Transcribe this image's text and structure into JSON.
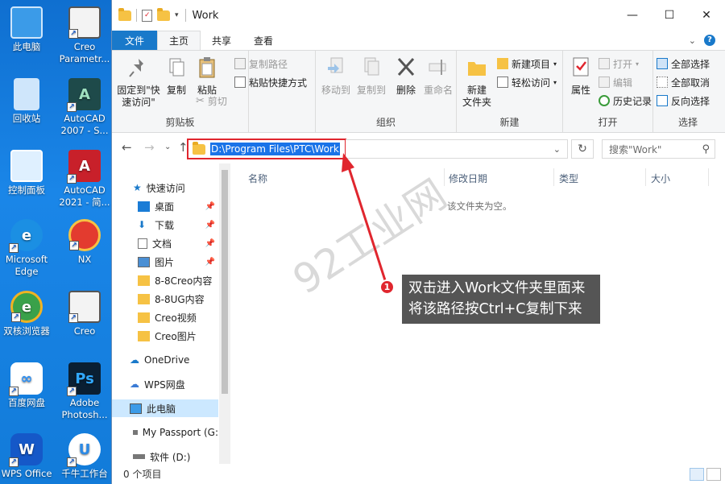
{
  "desktop": {
    "icons": [
      {
        "label": "此电脑"
      },
      {
        "label": "Creo Parametr..."
      },
      {
        "label": "回收站"
      },
      {
        "label": "AutoCAD 2007 - S..."
      },
      {
        "label": "控制面板"
      },
      {
        "label": "AutoCAD 2021 - 简..."
      },
      {
        "label": "Microsoft Edge"
      },
      {
        "label": "NX"
      },
      {
        "label": "双核浏览器"
      },
      {
        "label": "Creo"
      },
      {
        "label": "百度网盘"
      },
      {
        "label": "Adobe Photosh..."
      },
      {
        "label": "WPS Office"
      },
      {
        "label": "千牛工作台"
      }
    ]
  },
  "window": {
    "title": "Work",
    "controls": {
      "minimize": "—",
      "maximize": "☐",
      "close": "✕"
    }
  },
  "tabs": {
    "file": "文件",
    "home": "主页",
    "share": "共享",
    "view": "查看"
  },
  "ribbon": {
    "clipboard": {
      "pin": "固定到\"快速访问\"",
      "copy": "复制",
      "paste": "粘贴",
      "copy_path": "复制路径",
      "paste_shortcut": "粘贴快捷方式",
      "cut": "剪切",
      "label": "剪贴板"
    },
    "organize": {
      "move_to": "移动到",
      "copy_to": "复制到",
      "delete": "删除",
      "rename": "重命名",
      "label": "组织"
    },
    "new": {
      "new_folder": "新建\n文件夹",
      "new_item": "新建项目",
      "easy_access": "轻松访问",
      "label": "新建"
    },
    "open": {
      "properties": "属性",
      "open": "打开",
      "edit": "编辑",
      "history": "历史记录",
      "label": "打开"
    },
    "select": {
      "select_all": "全部选择",
      "select_none": "全部取消",
      "invert": "反向选择",
      "label": "选择"
    }
  },
  "address": {
    "path": "D:\\Program Files\\PTC\\Work",
    "search_placeholder": "搜索\"Work\""
  },
  "nav": {
    "items": [
      {
        "label": "快速访问"
      },
      {
        "label": "桌面"
      },
      {
        "label": "下载"
      },
      {
        "label": "文档"
      },
      {
        "label": "图片"
      },
      {
        "label": "8-8Creo内容"
      },
      {
        "label": "8-8UG内容"
      },
      {
        "label": "Creo视频"
      },
      {
        "label": "Creo图片"
      },
      {
        "label": "OneDrive"
      },
      {
        "label": "WPS网盘"
      },
      {
        "label": "此电脑"
      },
      {
        "label": "My Passport (G:"
      },
      {
        "label": "软件 (D:)"
      }
    ]
  },
  "columns": {
    "name": "名称",
    "date": "修改日期",
    "type": "类型",
    "size": "大小"
  },
  "empty_message": "该文件夹为空。",
  "status": {
    "count": "0 个项目"
  },
  "annotation": {
    "badge": "1",
    "text_line1": "双击进入Work文件夹里面来",
    "text_line2": "将该路径按Ctrl+C复制下来",
    "watermark": "92工业网"
  },
  "colors": {
    "accent": "#1979ca",
    "selection": "#1a73e8",
    "annotation_red": "#e0262e",
    "callout_bg": "#555555"
  }
}
